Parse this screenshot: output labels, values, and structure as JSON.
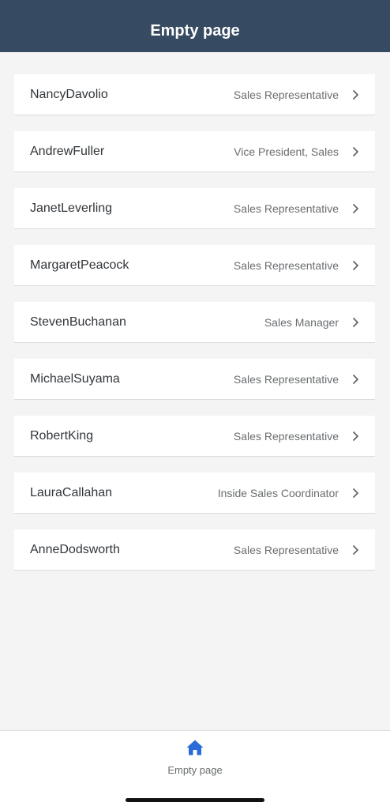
{
  "header": {
    "title": "Empty page"
  },
  "list": {
    "items": [
      {
        "name": "NancyDavolio",
        "title": "Sales Representative"
      },
      {
        "name": "AndrewFuller",
        "title": "Vice President, Sales"
      },
      {
        "name": "JanetLeverling",
        "title": "Sales Representative"
      },
      {
        "name": "MargaretPeacock",
        "title": "Sales Representative"
      },
      {
        "name": "StevenBuchanan",
        "title": "Sales Manager"
      },
      {
        "name": "MichaelSuyama",
        "title": "Sales Representative"
      },
      {
        "name": "RobertKing",
        "title": "Sales Representative"
      },
      {
        "name": "LauraCallahan",
        "title": "Inside Sales Coordinator"
      },
      {
        "name": "AnneDodsworth",
        "title": "Sales Representative"
      }
    ]
  },
  "tabbar": {
    "home_label": "Empty page",
    "home_icon": "home-icon"
  },
  "colors": {
    "header_bg": "#364a61",
    "accent": "#2a6bd8",
    "page_bg": "#f4f4f4"
  }
}
